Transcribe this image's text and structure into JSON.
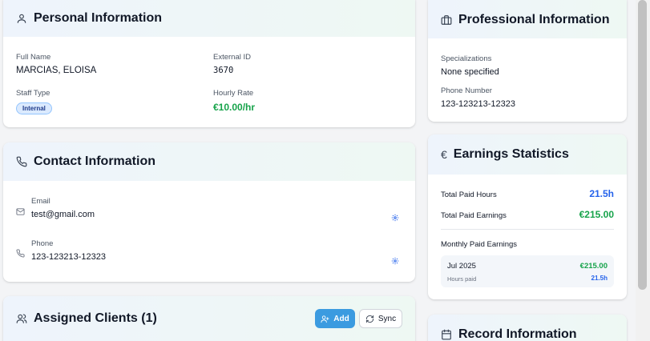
{
  "personal": {
    "title": "Personal Information",
    "full_name_label": "Full Name",
    "full_name": "MARCIAS, ELOISA",
    "external_id_label": "External ID",
    "external_id": "3670",
    "staff_type_label": "Staff Type",
    "staff_type": "Internal",
    "hourly_rate_label": "Hourly Rate",
    "hourly_rate": "€10.00/hr"
  },
  "contact": {
    "title": "Contact Information",
    "email_label": "Email",
    "email": "test@gmail.com",
    "phone_label": "Phone",
    "phone": "123-123213-12323"
  },
  "clients": {
    "title": "Assigned Clients (1)",
    "add_label": "Add",
    "sync_label": "Sync"
  },
  "professional": {
    "title": "Professional Information",
    "specializations_label": "Specializations",
    "specializations": "None specified",
    "phone_label": "Phone Number",
    "phone": "123-123213-12323"
  },
  "earnings": {
    "title": "Earnings Statistics",
    "total_hours_label": "Total Paid Hours",
    "total_hours": "21.5h",
    "total_earnings_label": "Total Paid Earnings",
    "total_earnings": "€215.00",
    "monthly_label": "Monthly Paid Earnings",
    "months": [
      {
        "month": "Jul 2025",
        "amount": "€215.00",
        "hours_label": "Hours paid",
        "hours": "21.5h"
      }
    ]
  },
  "record": {
    "title": "Record Information"
  },
  "colors": {
    "accent": "#2563eb",
    "money": "#16a34a",
    "add_button": "#3b9be0"
  },
  "icons": [
    "user-icon",
    "briefcase-icon",
    "euro-icon",
    "phone-icon",
    "mail-icon",
    "gear-icon",
    "users-icon",
    "user-plus-icon",
    "refresh-icon",
    "calendar-icon"
  ]
}
